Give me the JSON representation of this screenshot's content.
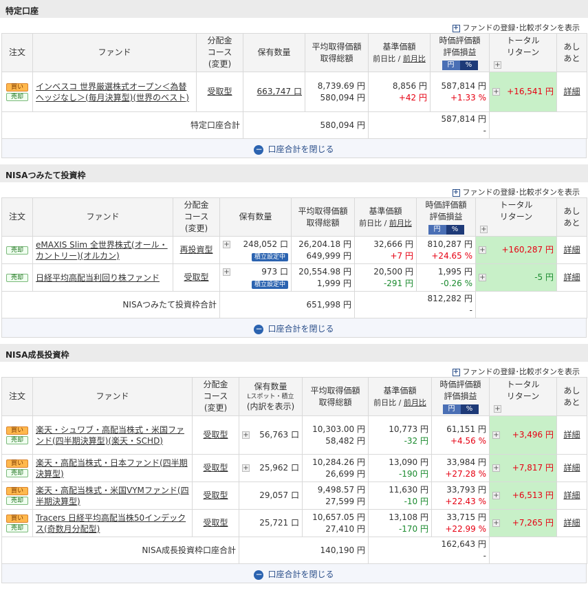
{
  "common": {
    "register_compare": "ファンドの登録･比較ボタンを表示",
    "close_total": "口座合計を閉じる",
    "buy": "買い",
    "sell": "売却",
    "detail": "詳細",
    "yen_label": "円",
    "pct_label": "%",
    "tumitate_badge": "積立設定中"
  },
  "headers": {
    "order": "注文",
    "fund": "ファンド",
    "course1": "分配金",
    "course2": "コース",
    "course3": "(変更)",
    "qty": "保有数量",
    "qty_sub1": "Lスポット・積立",
    "qty_sub2": "(内訳を表示)",
    "avg1": "平均取得価額",
    "avg2": "取得総額",
    "base1": "基準価額",
    "base2a": "前日比 / ",
    "base2b": "前月比",
    "val1": "時価評価額",
    "val2": "評価損益",
    "ret1": "トータル",
    "ret2": "リターン",
    "ashi1": "あし",
    "ashi2": "あと"
  },
  "tokutei": {
    "title": "特定口座",
    "rows": [
      {
        "fund": "インベスコ 世界厳選株式オープン＜為替ヘッジなし＞(毎月決算型)(世界のベスト)",
        "course": "受取型",
        "qty": "663,747 口",
        "avg": "8,739.69 円",
        "total_cost": "580,094 円",
        "base": "8,856 円",
        "diff": "+42 円",
        "value": "587,814 円",
        "pl": "+1.33 %",
        "ret": "+16,541 円"
      }
    ],
    "total_label": "特定口座合計",
    "total_cost": "580,094 円",
    "total_value": "587,814 円",
    "total_pl": "-"
  },
  "nisa_tsumitate": {
    "title": "NISAつみたて投資枠",
    "rows": [
      {
        "fund": "eMAXIS Slim 全世界株式(オール・カントリー)(オルカン)",
        "course": "再投資型",
        "qty": "248,052 口",
        "avg": "26,204.18 円",
        "total_cost": "649,999 円",
        "base": "32,666 円",
        "diff": "+7 円",
        "value": "810,287 円",
        "pl": "+24.65 %",
        "ret": "+160,287 円"
      },
      {
        "fund": "日経平均高配当利回り株ファンド",
        "course": "受取型",
        "qty": "973 口",
        "avg": "20,554.98 円",
        "total_cost": "1,999 円",
        "base": "20,500 円",
        "diff": "-291 円",
        "value": "1,995 円",
        "pl": "-0.26 %",
        "ret": "-5 円"
      }
    ],
    "total_label": "NISAつみたて投資枠合計",
    "total_cost": "651,998 円",
    "total_value": "812,282 円",
    "total_pl": "-"
  },
  "nisa_growth": {
    "title": "NISA成長投資枠",
    "rows": [
      {
        "fund": "楽天・シュワブ・高配当株式・米国ファンド(四半期決算型)(楽天・SCHD)",
        "course": "受取型",
        "qty": "56,763 口",
        "avg": "10,303.00 円",
        "total_cost": "58,482 円",
        "base": "10,773 円",
        "diff": "-32 円",
        "value": "61,151 円",
        "pl": "+4.56 %",
        "ret": "+3,496 円"
      },
      {
        "fund": "楽天・高配当株式・日本ファンド(四半期決算型)",
        "course": "受取型",
        "qty": "25,962 口",
        "avg": "10,284.26 円",
        "total_cost": "26,699 円",
        "base": "13,090 円",
        "diff": "-190 円",
        "value": "33,984 円",
        "pl": "+27.28 %",
        "ret": "+7,817 円"
      },
      {
        "fund": "楽天・高配当株式・米国VYMファンド(四半期決算型)",
        "course": "受取型",
        "qty": "29,057 口",
        "avg": "9,498.57 円",
        "total_cost": "27,599 円",
        "base": "11,630 円",
        "diff": "-10 円",
        "value": "33,793 円",
        "pl": "+22.43 %",
        "ret": "+6,513 円"
      },
      {
        "fund": "Tracers 日経平均高配当株50インデックス(奇数月分配型)",
        "course": "受取型",
        "qty": "25,721 口",
        "avg": "10,657.05 円",
        "total_cost": "27,410 円",
        "base": "13,108 円",
        "diff": "-170 円",
        "value": "33,715 円",
        "pl": "+22.99 %",
        "ret": "+7,265 円"
      }
    ],
    "total_label": "NISA成長投資枠口座合計",
    "total_cost": "140,190 円",
    "total_value": "162,643 円",
    "total_pl": "-"
  }
}
